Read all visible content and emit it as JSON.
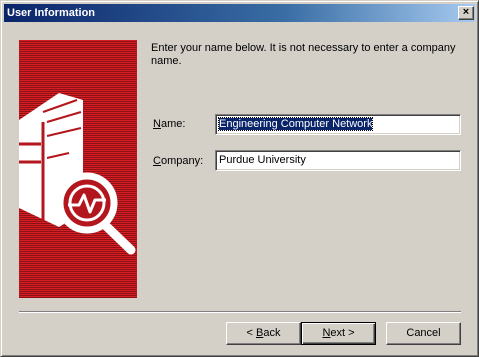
{
  "window": {
    "title": "User Information",
    "close_glyph": "×"
  },
  "banner": {
    "icon": "server-monitor-icon",
    "colors": {
      "red": "#b3161c",
      "white": "#ffffff"
    }
  },
  "prompt": {
    "text": "Enter your name below.  It is not necessary to enter a company name."
  },
  "form": {
    "name": {
      "label_mnemonic": "N",
      "label_rest": "ame:",
      "value": "Engineering Computer Network",
      "selected": true
    },
    "company": {
      "label_mnemonic": "C",
      "label_rest": "ompany:",
      "value": "Purdue University"
    }
  },
  "buttons": {
    "back": {
      "prefix": "< ",
      "mnemonic": "B",
      "rest": "ack"
    },
    "next": {
      "mnemonic": "N",
      "rest": "ext >",
      "default": true
    },
    "cancel": {
      "label": "Cancel"
    }
  }
}
